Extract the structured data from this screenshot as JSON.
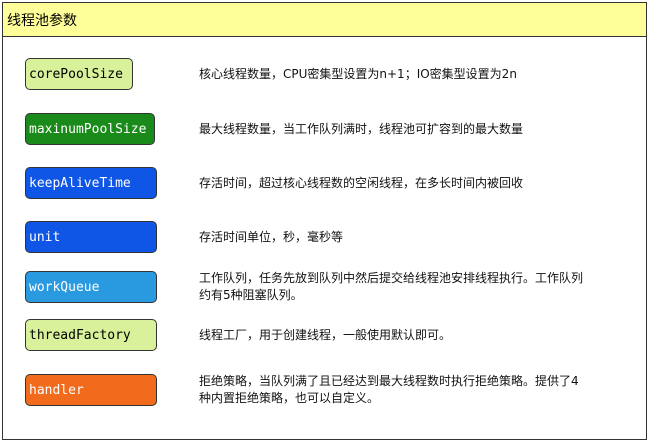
{
  "title": "线程池参数",
  "params": [
    {
      "name": "corePoolSize",
      "fill": "#d9f19a",
      "text_color": "#000000",
      "desc": "核心线程数量，CPU密集型设置为n+1；IO密集型设置为2n"
    },
    {
      "name": "maxinumPoolSize",
      "fill": "#1a8a1a",
      "text_color": "#ffffff",
      "desc": "最大线程数量，当工作队列满时，线程池可扩容到的最大数量"
    },
    {
      "name": "keepAliveTime",
      "fill": "#0f56e6",
      "text_color": "#ffffff",
      "desc": "存活时间，超过核心线程数的空闲线程，在多长时间内被回收"
    },
    {
      "name": "unit",
      "fill": "#0f56e6",
      "text_color": "#ffffff",
      "desc": "存活时间单位，秒，毫秒等"
    },
    {
      "name": "workQueue",
      "fill": "#2a9ae0",
      "text_color": "#ffffff",
      "desc": "工作队列，任务先放到队列中然后提交给线程池安排线程执行。工作队列约有5种阻塞队列。"
    },
    {
      "name": "threadFactory",
      "fill": "#d9f19a",
      "text_color": "#000000",
      "desc": "线程工厂，用于创建线程，一般使用默认即可。"
    },
    {
      "name": "handler",
      "fill": "#f26b1d",
      "text_color": "#ffffff",
      "desc": "拒绝策略，当队列满了且已经达到最大线程数时执行拒绝策略。提供了4种内置拒绝策略，也可以自定义。"
    }
  ]
}
